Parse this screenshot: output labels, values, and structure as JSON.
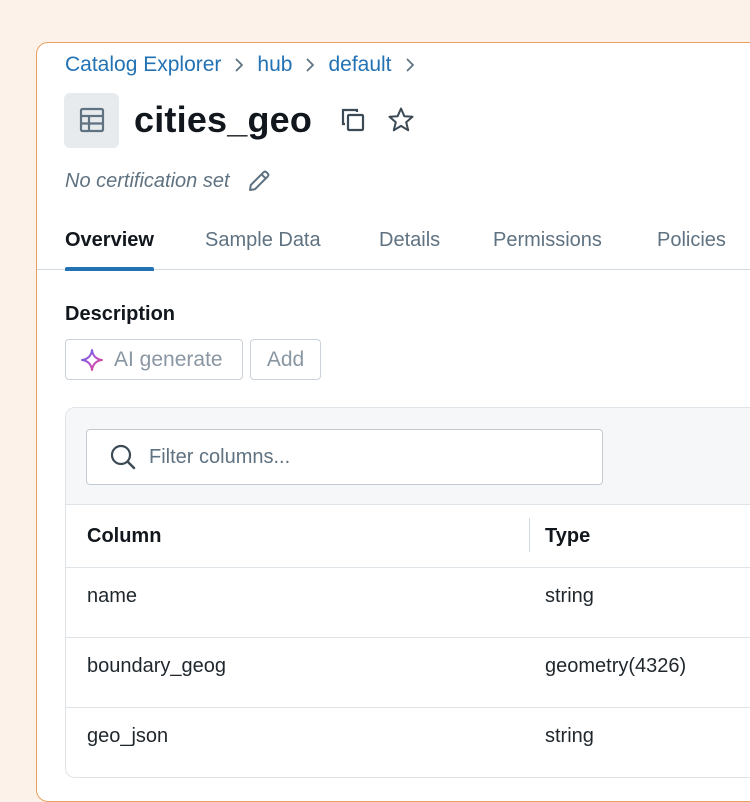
{
  "breadcrumb": {
    "items": [
      "Catalog Explorer",
      "hub",
      "default"
    ]
  },
  "header": {
    "title": "cities_geo",
    "icons": {
      "table": "table-icon",
      "copy": "copy-icon",
      "favorite": "star-icon"
    }
  },
  "certification": {
    "text": "No certification set",
    "edit_icon": "pencil-icon"
  },
  "tabs": [
    {
      "label": "Overview",
      "active": true
    },
    {
      "label": "Sample Data",
      "active": false
    },
    {
      "label": "Details",
      "active": false
    },
    {
      "label": "Permissions",
      "active": false
    },
    {
      "label": "Policies",
      "active": false
    }
  ],
  "description": {
    "label": "Description",
    "ai_generate_label": "AI generate",
    "add_label": "Add"
  },
  "columns_table": {
    "filter_placeholder": "Filter columns...",
    "headers": [
      "Column",
      "Type"
    ],
    "rows": [
      {
        "name": "name",
        "type": "string"
      },
      {
        "name": "boundary_geog",
        "type": "geometry(4326)"
      },
      {
        "name": "geo_json",
        "type": "string"
      }
    ]
  },
  "colors": {
    "accent": "#2272b4",
    "background": "#fdf2e9",
    "panel_border": "#e8a160",
    "muted_text": "#5f7281"
  }
}
